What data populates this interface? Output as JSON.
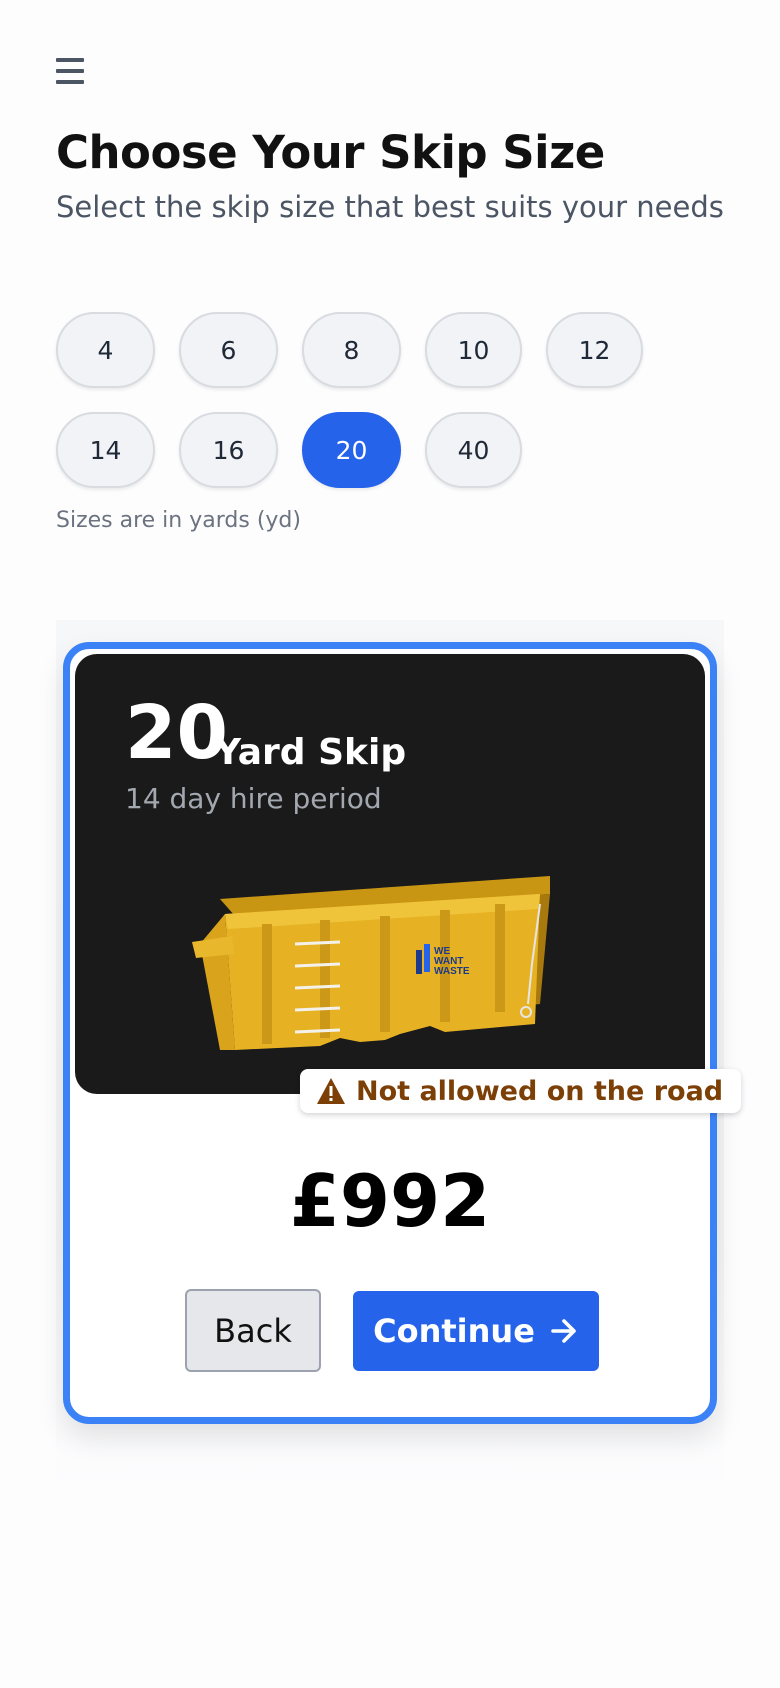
{
  "header": {
    "menu_icon": "hamburger-menu-icon",
    "title": "Choose Your Skip Size",
    "subtitle": "Select the skip size that best suits your needs"
  },
  "sizes": {
    "row1": [
      "4",
      "6",
      "8",
      "10",
      "12"
    ],
    "row2": [
      "14",
      "16",
      "20",
      "40"
    ],
    "selected": "20",
    "note": "Sizes are in yards (yd)"
  },
  "card": {
    "yards": "20",
    "label": "Yard Skip",
    "hire_period": "14 day hire period",
    "image_brand_lines": [
      "WE",
      "WANT",
      "WASTE"
    ],
    "warning": "Not allowed on the road",
    "warning_icon": "warning-triangle-icon",
    "price": "£992",
    "back_label": "Back",
    "continue_label": "Continue",
    "continue_icon": "arrow-right-icon"
  },
  "colors": {
    "accent": "#2563eb",
    "card_border": "#3b82f6",
    "warning_text": "#7c3f06",
    "skip_yellow": "#e6b224"
  }
}
